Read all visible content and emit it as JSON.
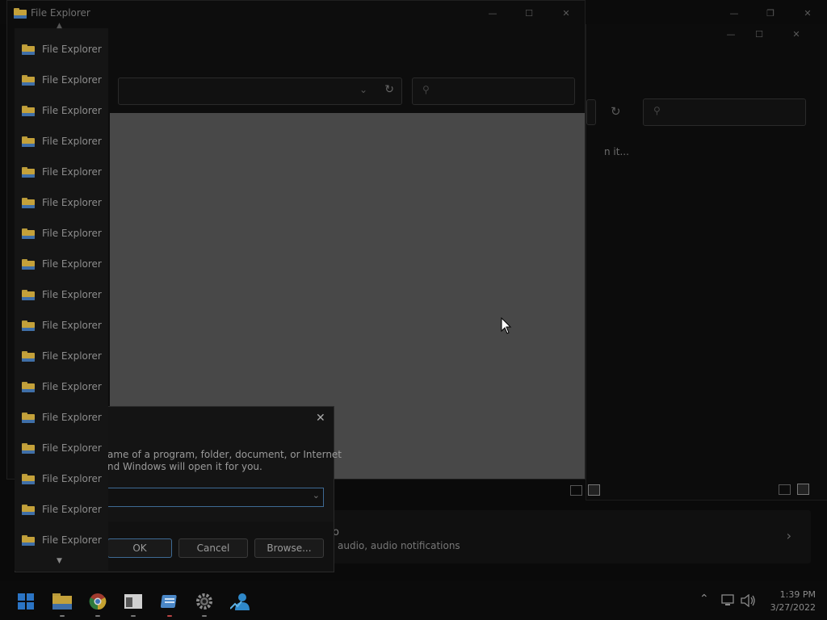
{
  "windows": {
    "front": {
      "title": "File Explorer",
      "search_placeholder": ""
    },
    "back": {
      "status_text": "n it..."
    }
  },
  "jump_list": {
    "items": [
      {
        "label": "File Explorer"
      },
      {
        "label": "File Explorer"
      },
      {
        "label": "File Explorer"
      },
      {
        "label": "File Explorer"
      },
      {
        "label": "File Explorer"
      },
      {
        "label": "File Explorer"
      },
      {
        "label": "File Explorer"
      },
      {
        "label": "File Explorer"
      },
      {
        "label": "File Explorer"
      },
      {
        "label": "File Explorer"
      },
      {
        "label": "File Explorer"
      },
      {
        "label": "File Explorer"
      },
      {
        "label": "File Explorer"
      },
      {
        "label": "File Explorer"
      },
      {
        "label": "File Explorer"
      },
      {
        "label": "File Explorer"
      },
      {
        "label": "File Explorer"
      }
    ]
  },
  "run_dialog": {
    "description_line1": "ame of a program, folder, document, or Internet",
    "description_line2": "nd Windows will open it for you.",
    "input_value": "",
    "ok_label": "OK",
    "cancel_label": "Cancel",
    "browse_label": "Browse..."
  },
  "settings_row": {
    "title": "o",
    "subtitle": "audio, audio notifications"
  },
  "taskbar": {
    "time": "1:39 PM",
    "date": "3/27/2022",
    "apps": [
      "start-icon",
      "file-explorer-icon",
      "chrome-icon",
      "app-window-icon",
      "notepad-icon",
      "settings-icon",
      "people-icon"
    ]
  },
  "colors": {
    "background": "#0a0a0a",
    "gray_panel": "#484848",
    "accent": "#2b74c4"
  }
}
